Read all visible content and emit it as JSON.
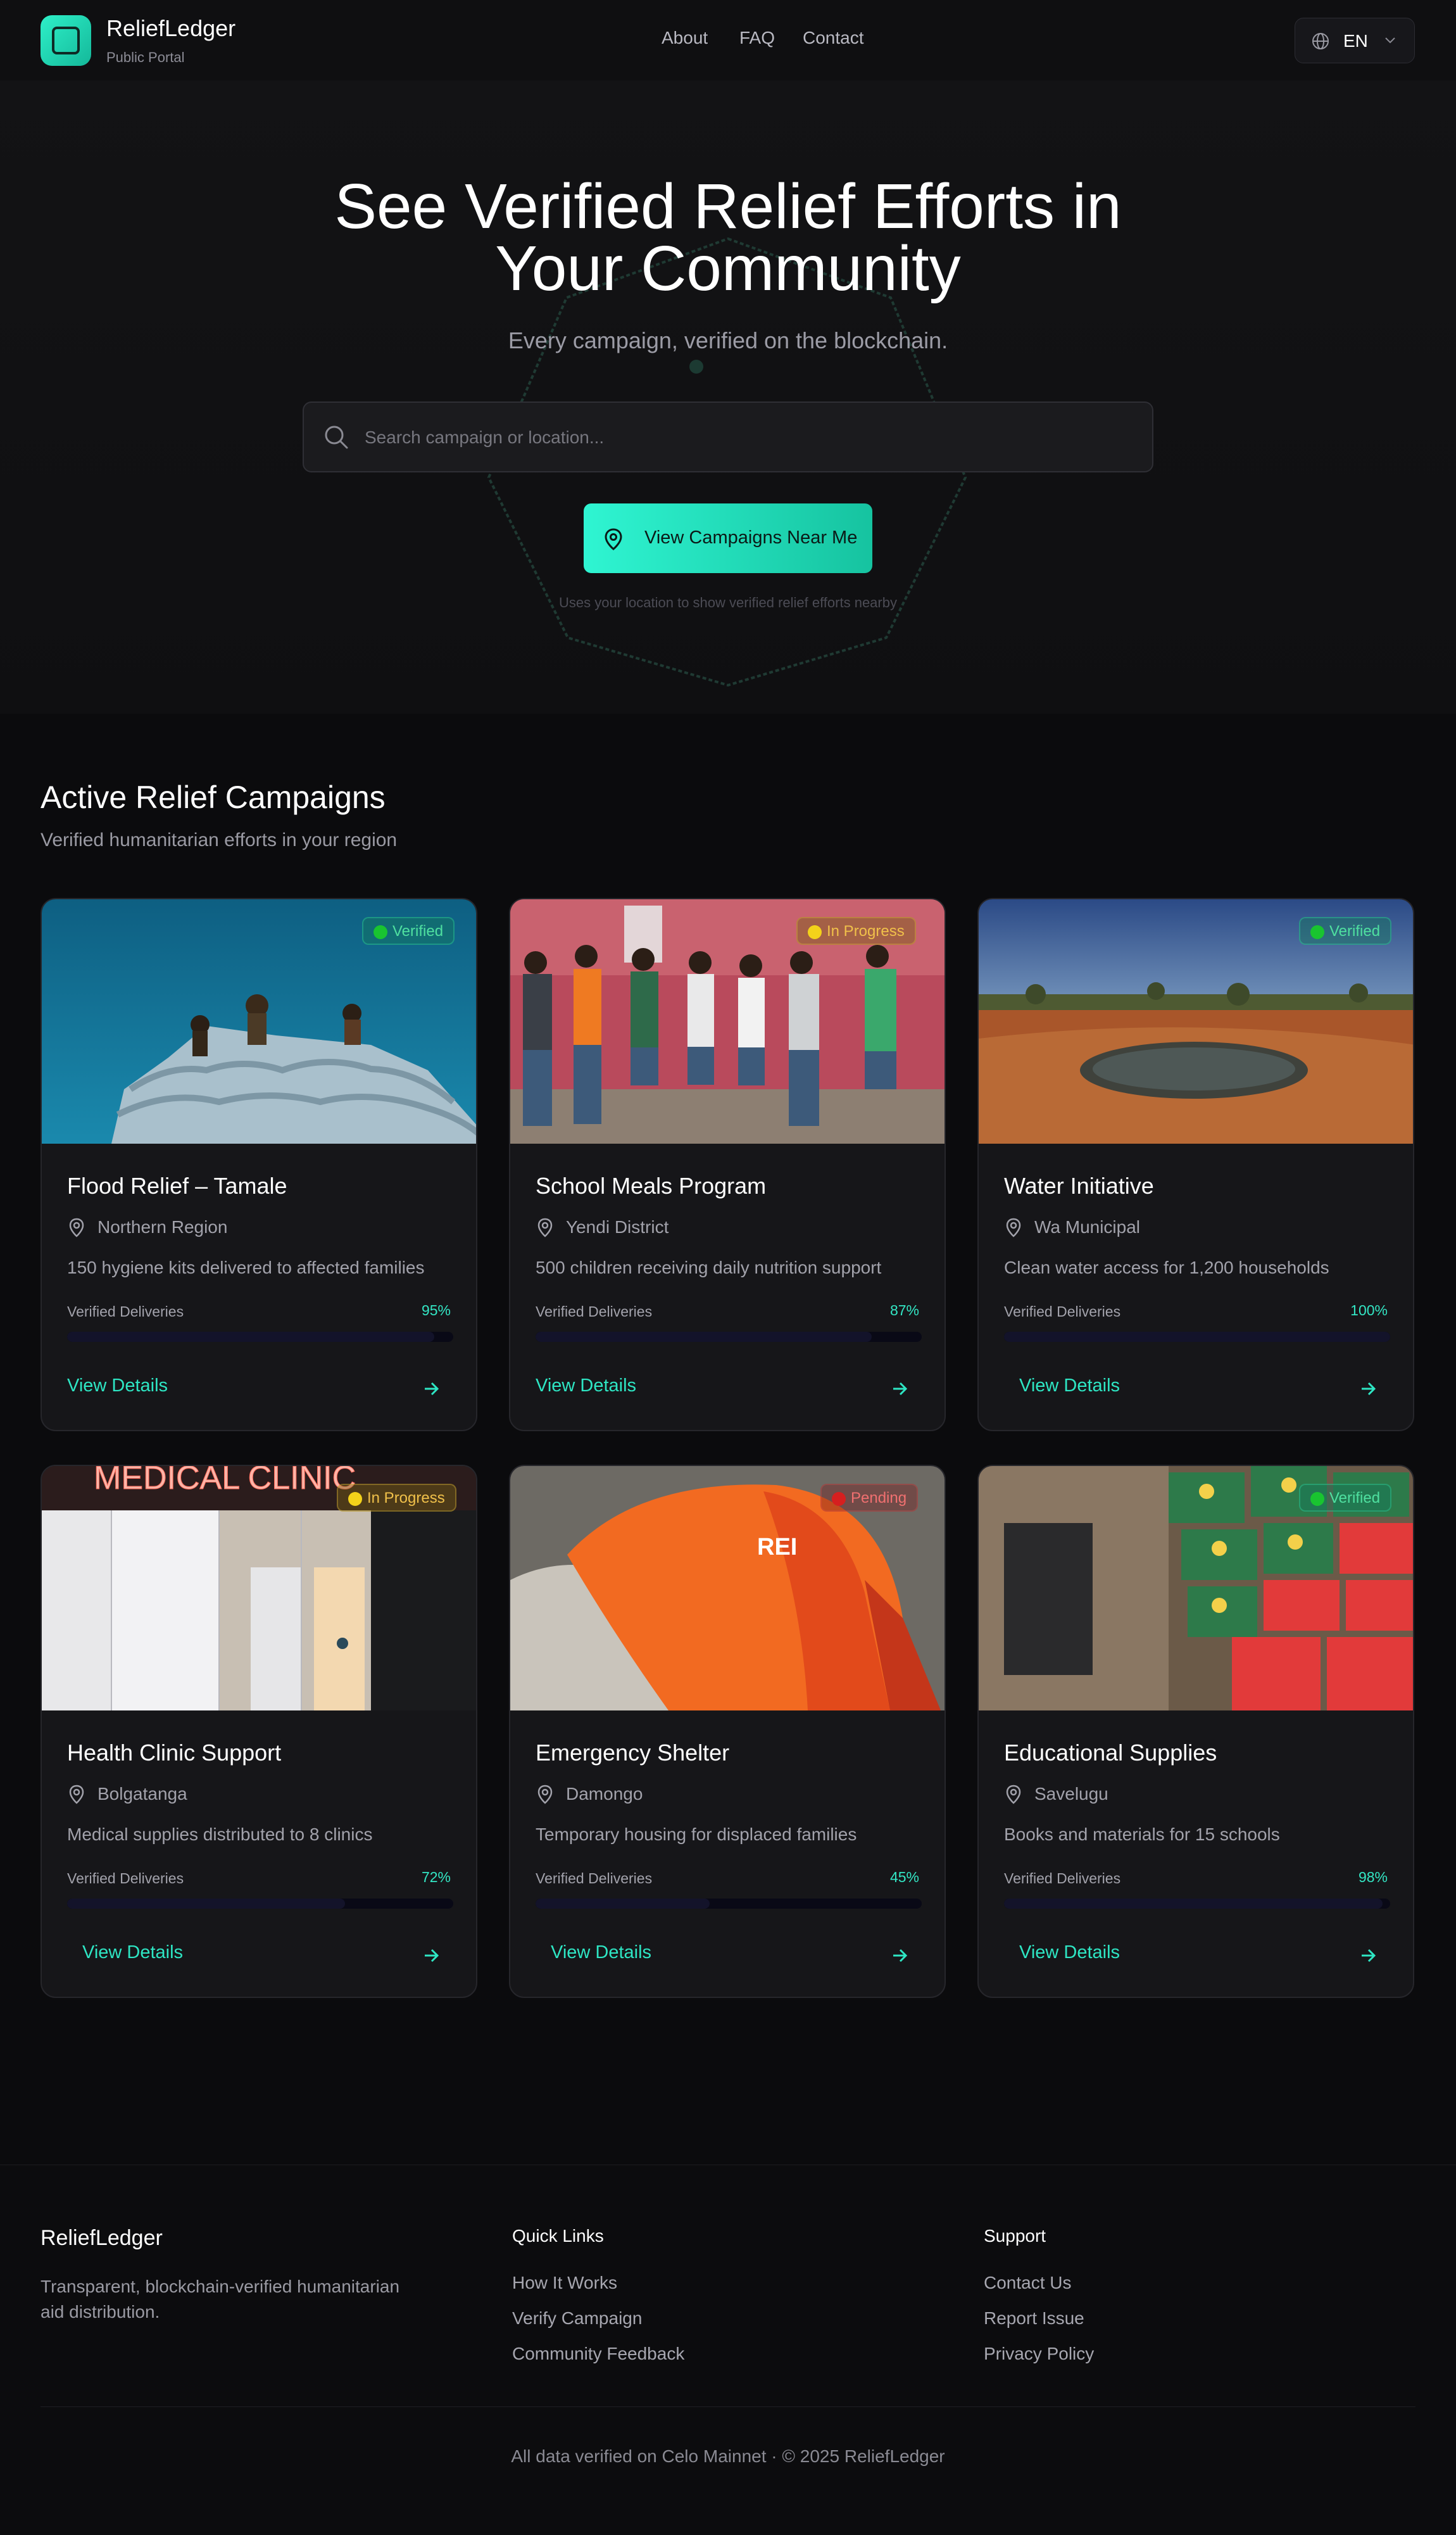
{
  "header": {
    "brand": "ReliefLedger",
    "brand_sub": "Public Portal",
    "nav": [
      "About",
      "FAQ",
      "Contact"
    ],
    "language": "EN"
  },
  "hero": {
    "title_line1": "See Verified Relief Efforts in",
    "title_line2": "Your Community",
    "subtitle": "Every campaign, verified on the blockchain.",
    "search_placeholder": "Search campaign or location...",
    "cta_label": "View Campaigns Near Me",
    "note": "Uses your location to show verified relief efforts nearby"
  },
  "campaigns": {
    "title": "Active Relief Campaigns",
    "subtitle": "Verified humanitarian efforts in your region",
    "progress_label": "Verified Deliveries",
    "link_label": "View Details",
    "items": [
      {
        "title": "Flood Relief – Tamale",
        "location": "Northern Region",
        "description": "150 hygiene kits delivered to affected families",
        "status": "Verified",
        "progress": 95,
        "progress_text": "95%"
      },
      {
        "title": "School Meals Program",
        "location": "Yendi District",
        "description": "500 children receiving daily nutrition support",
        "status": "In Progress",
        "progress": 87,
        "progress_text": "87%"
      },
      {
        "title": "Water Initiative",
        "location": "Wa Municipal",
        "description": "Clean water access for 1,200 households",
        "status": "Verified",
        "progress": 100,
        "progress_text": "100%"
      },
      {
        "title": "Health Clinic Support",
        "location": "Bolgatanga",
        "description": "Medical supplies distributed to 8 clinics",
        "status": "In Progress",
        "progress": 72,
        "progress_text": "72%"
      },
      {
        "title": "Emergency Shelter",
        "location": "Damongo",
        "description": "Temporary housing for displaced families",
        "status": "Pending",
        "progress": 45,
        "progress_text": "45%"
      },
      {
        "title": "Educational Supplies",
        "location": "Savelugu",
        "description": "Books and materials for 15 schools",
        "status": "Verified",
        "progress": 98,
        "progress_text": "98%"
      }
    ],
    "clinic_sign": "MEDICAL CLINIC",
    "tent_logo": "REI"
  },
  "footer": {
    "brand": "ReliefLedger",
    "description": "Transparent, blockchain-verified humanitarian aid distribution.",
    "quick_links_title": "Quick Links",
    "quick_links": [
      "How It Works",
      "Verify Campaign",
      "Community Feedback"
    ],
    "support_title": "Support",
    "support_links": [
      "Contact Us",
      "Report Issue",
      "Privacy Policy"
    ],
    "copyright": "All data verified on Celo Mainnet · © 2025 ReliefLedger"
  },
  "colors": {
    "accent": "#2EE6C4",
    "background": "#0B0B0D",
    "card": "#161619",
    "verified": "#19C430",
    "in_progress": "#F3D21A",
    "pending": "#D61F1F"
  }
}
